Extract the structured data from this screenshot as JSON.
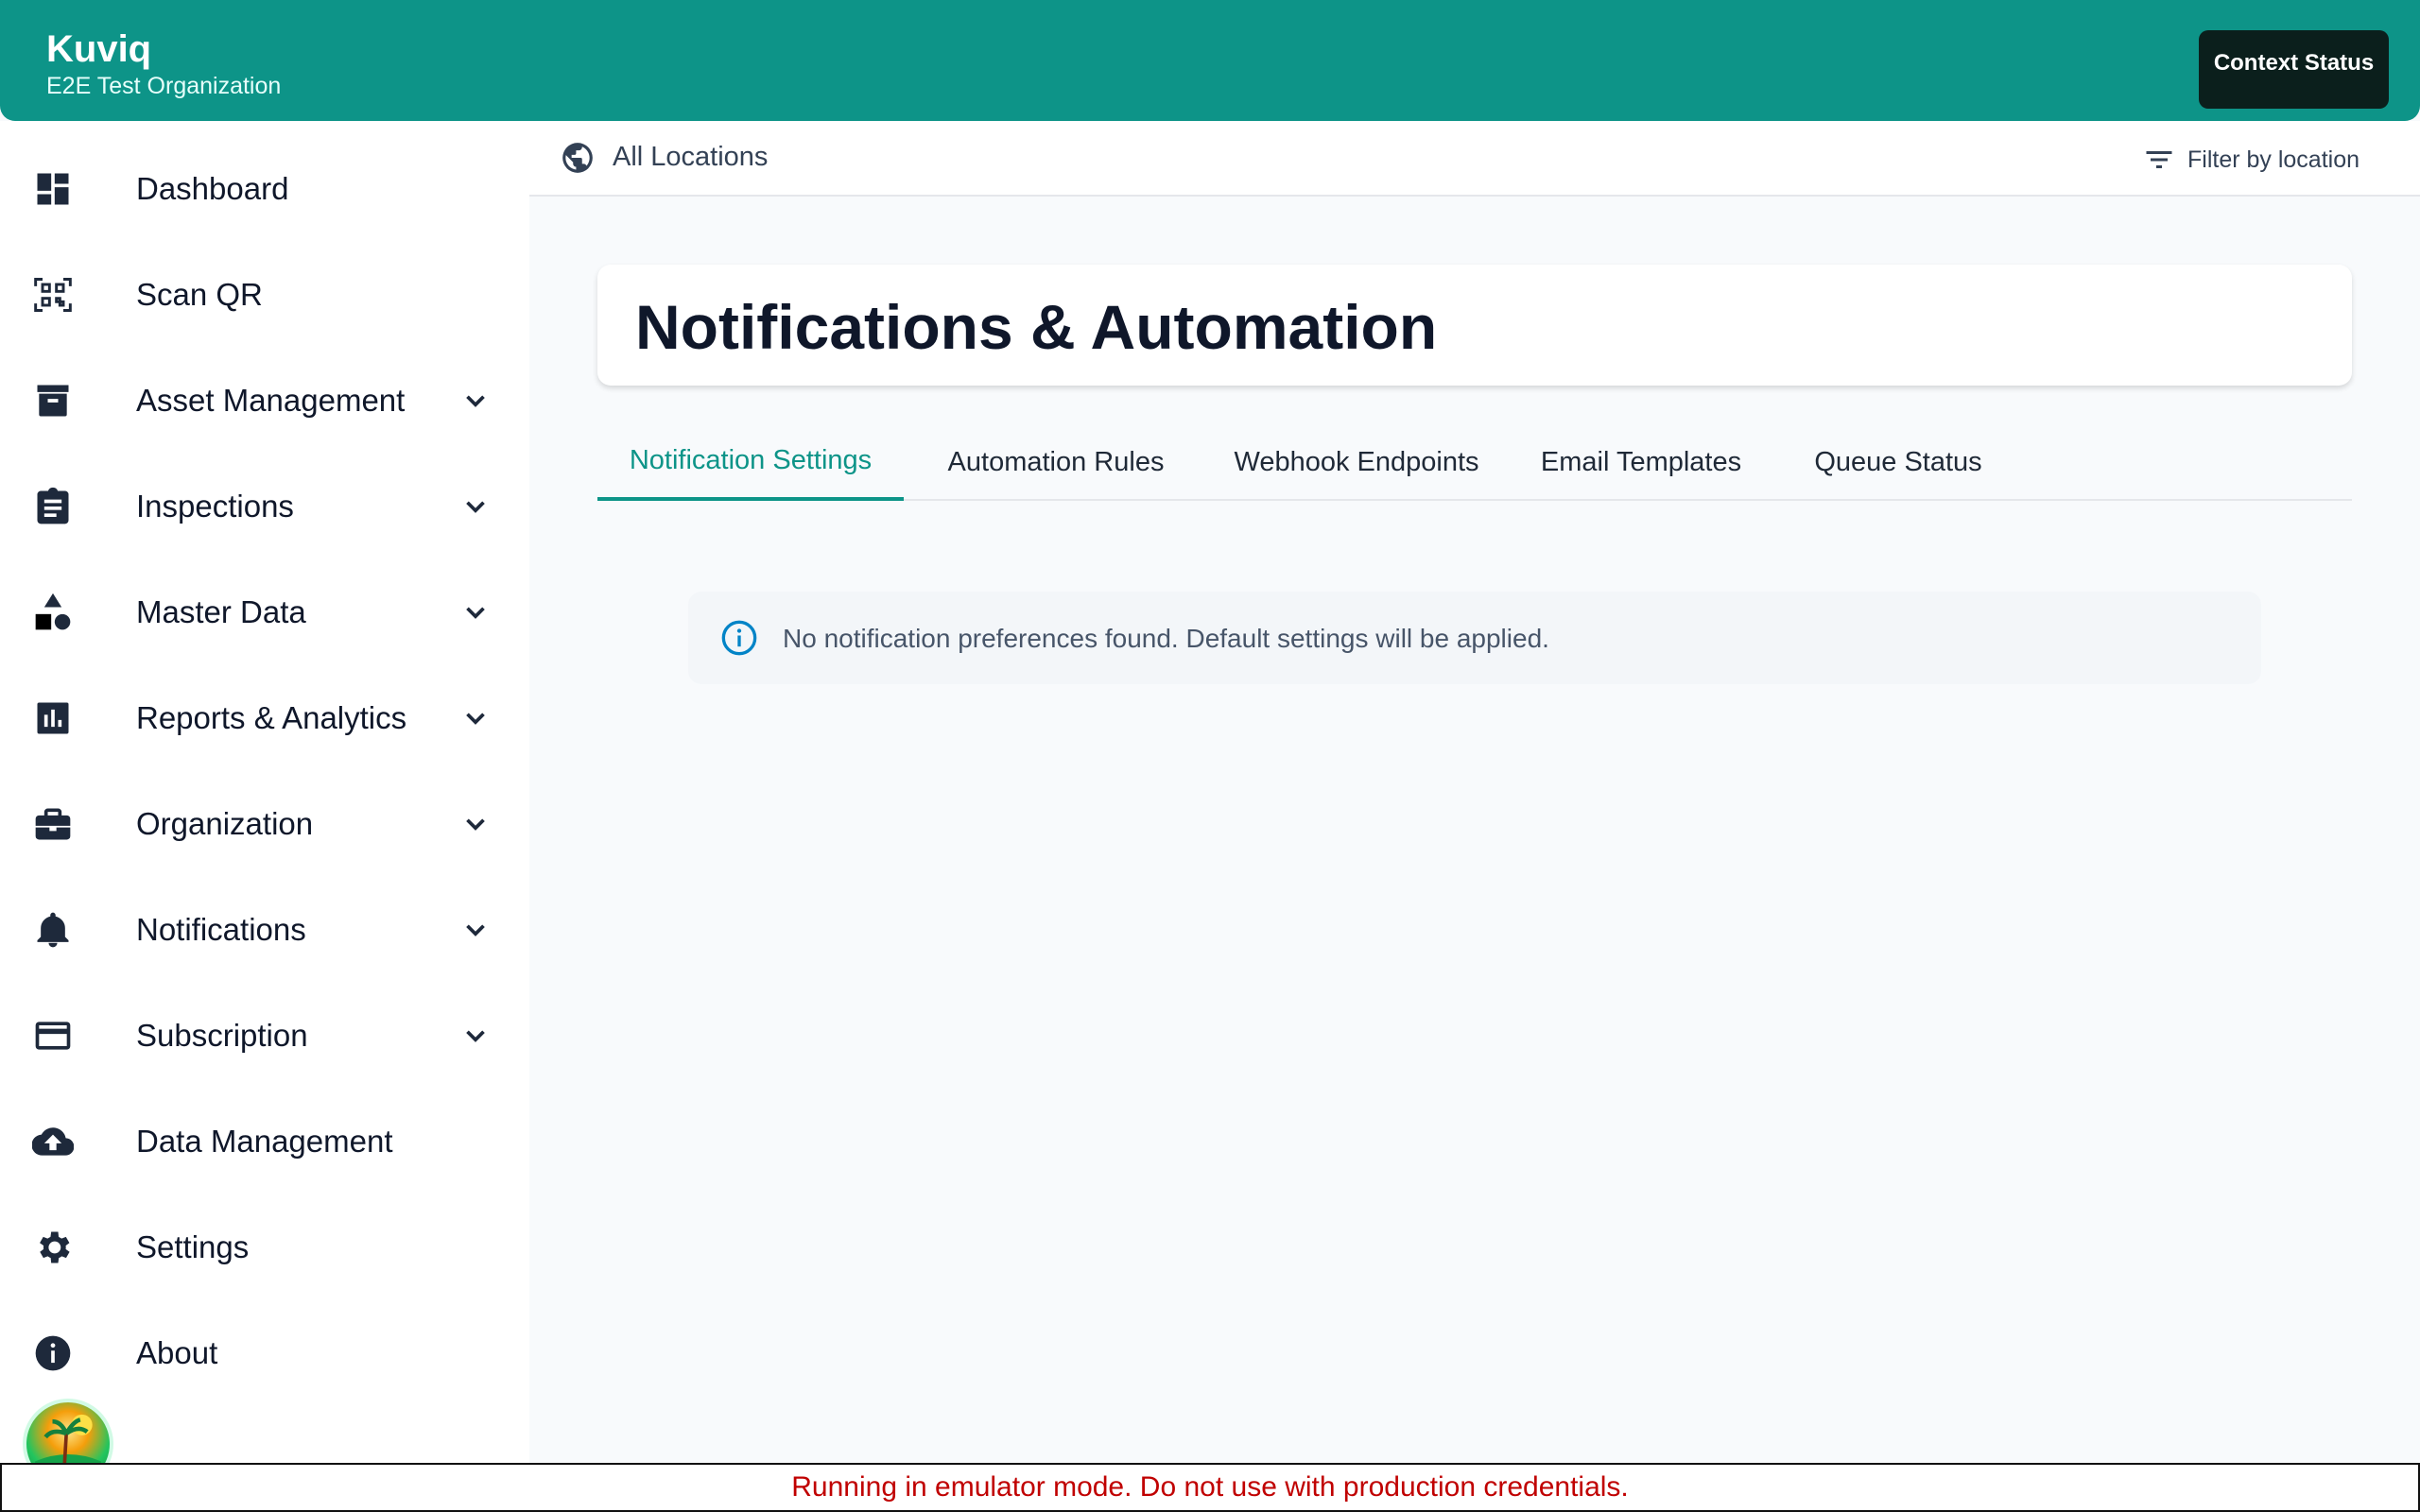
{
  "header": {
    "app_name": "Kuviq",
    "org_name": "E2E Test Organization",
    "context_button": "Context Status",
    "background": "#0d9488"
  },
  "sidebar": {
    "items": [
      {
        "label": "Dashboard",
        "icon": "dashboard-icon",
        "expandable": false
      },
      {
        "label": "Scan QR",
        "icon": "qr-scan-icon",
        "expandable": false
      },
      {
        "label": "Asset Management",
        "icon": "archive-icon",
        "expandable": true
      },
      {
        "label": "Inspections",
        "icon": "clipboard-icon",
        "expandable": true
      },
      {
        "label": "Master Data",
        "icon": "shapes-icon",
        "expandable": true
      },
      {
        "label": "Reports & Analytics",
        "icon": "bar-chart-icon",
        "expandable": true
      },
      {
        "label": "Organization",
        "icon": "briefcase-icon",
        "expandable": true
      },
      {
        "label": "Notifications",
        "icon": "bell-icon",
        "expandable": true
      },
      {
        "label": "Subscription",
        "icon": "credit-card-icon",
        "expandable": true
      },
      {
        "label": "Data Management",
        "icon": "cloud-upload-icon",
        "expandable": false
      },
      {
        "label": "Settings",
        "icon": "gear-icon",
        "expandable": false
      },
      {
        "label": "About",
        "icon": "info-icon",
        "expandable": false
      }
    ]
  },
  "location_bar": {
    "current": "All Locations",
    "filter_label": "Filter by location"
  },
  "page": {
    "title": "Notifications & Automation"
  },
  "tabs": [
    {
      "label": "Notification Settings",
      "active": true
    },
    {
      "label": "Automation Rules",
      "active": false
    },
    {
      "label": "Webhook Endpoints",
      "active": false
    },
    {
      "label": "Email Templates",
      "active": false
    },
    {
      "label": "Queue Status",
      "active": false
    }
  ],
  "info_alert": {
    "message": "No notification preferences found. Default settings will be applied."
  },
  "banner": {
    "message": "Running in emulator mode. Do not use with production credentials."
  },
  "colors": {
    "accent": "#0d9488",
    "banner_text": "#c00000"
  }
}
